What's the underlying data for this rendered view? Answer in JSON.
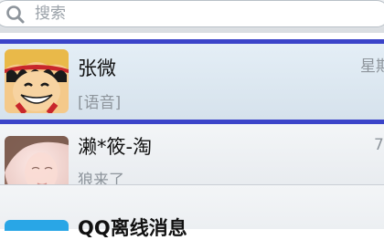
{
  "search": {
    "placeholder": "搜索"
  },
  "chats": [
    {
      "name": "张微",
      "preview": "[语音]",
      "time": "星期",
      "selected": true,
      "avatar_icon": "cartoon-pirate-avatar"
    },
    {
      "name": "濑*筱-淘",
      "preview": "狼来了",
      "time": "7",
      "selected": false,
      "avatar_icon": "person-photo-avatar"
    },
    {
      "name": "QQ离线消息",
      "selected": false,
      "avatar_icon": "qq-avatar"
    }
  ],
  "colors": {
    "selection_border": "#3b44c9",
    "qq_blue": "#29a6e6"
  }
}
